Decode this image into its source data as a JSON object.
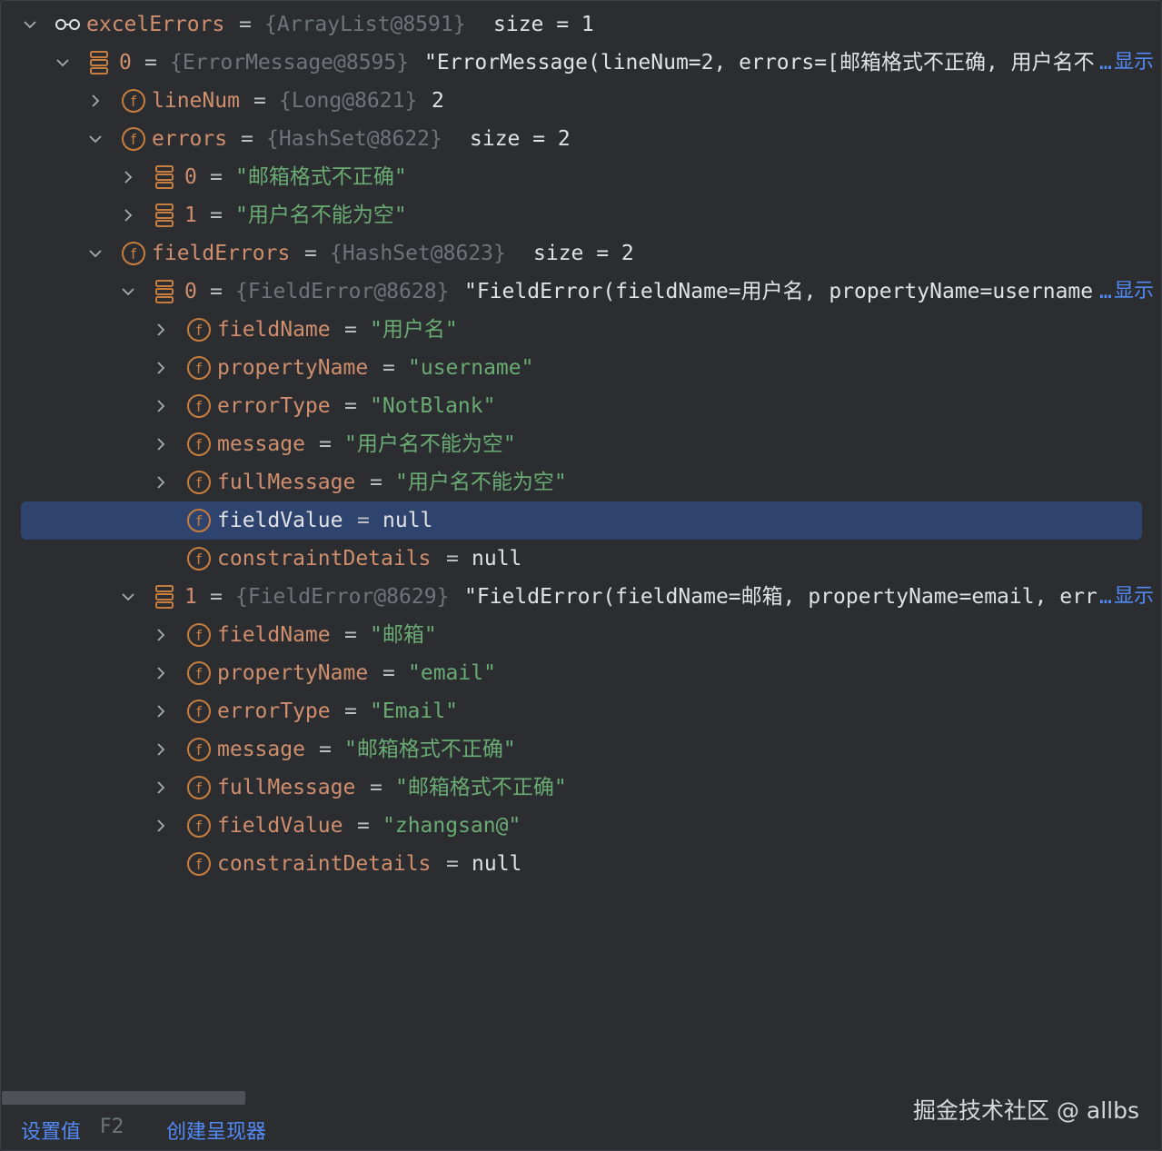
{
  "rows": [
    {
      "name": "excelErrors",
      "eq": "=",
      "ref": "{ArrayList@8591}",
      "extra": "size = 1"
    },
    {
      "name": "0",
      "eq": "=",
      "ref": "{ErrorMessage@8595}",
      "value": "\"ErrorMessage(lineNum=2, errors=[邮箱格式不正确, 用户名不",
      "ellipsis": "…",
      "show": "显示"
    },
    {
      "name": "lineNum",
      "eq": "=",
      "ref": "{Long@8621}",
      "value": "2"
    },
    {
      "name": "errors",
      "eq": "=",
      "ref": "{HashSet@8622}",
      "extra": "size = 2"
    },
    {
      "name": "0",
      "eq": "=",
      "value": "\"邮箱格式不正确\""
    },
    {
      "name": "1",
      "eq": "=",
      "value": "\"用户名不能为空\""
    },
    {
      "name": "fieldErrors",
      "eq": "=",
      "ref": "{HashSet@8623}",
      "extra": "size = 2"
    },
    {
      "name": "0",
      "eq": "=",
      "ref": "{FieldError@8628}",
      "value": "\"FieldError(fieldName=用户名, propertyName=username",
      "ellipsis": "…",
      "show": "显示"
    },
    {
      "name": "fieldName",
      "eq": "=",
      "value": "\"用户名\""
    },
    {
      "name": "propertyName",
      "eq": "=",
      "value": "\"username\""
    },
    {
      "name": "errorType",
      "eq": "=",
      "value": "\"NotBlank\""
    },
    {
      "name": "message",
      "eq": "=",
      "value": "\"用户名不能为空\""
    },
    {
      "name": "fullMessage",
      "eq": "=",
      "value": "\"用户名不能为空\""
    },
    {
      "name": "fieldValue",
      "eq": "=",
      "value": "null"
    },
    {
      "name": "constraintDetails",
      "eq": "=",
      "value": "null"
    },
    {
      "name": "1",
      "eq": "=",
      "ref": "{FieldError@8629}",
      "value": "\"FieldError(fieldName=邮箱, propertyName=email, err",
      "ellipsis": "…",
      "show": "显示"
    },
    {
      "name": "fieldName",
      "eq": "=",
      "value": "\"邮箱\""
    },
    {
      "name": "propertyName",
      "eq": "=",
      "value": "\"email\""
    },
    {
      "name": "errorType",
      "eq": "=",
      "value": "\"Email\""
    },
    {
      "name": "message",
      "eq": "=",
      "value": "\"邮箱格式不正确\""
    },
    {
      "name": "fullMessage",
      "eq": "=",
      "value": "\"邮箱格式不正确\""
    },
    {
      "name": "fieldValue",
      "eq": "=",
      "value": "\"zhangsan@\""
    },
    {
      "name": "constraintDetails",
      "eq": "=",
      "value": "null"
    }
  ],
  "bottom": {
    "set_value": "设置值",
    "set_value_shortcut": "F2",
    "create_renderer": "创建呈现器"
  },
  "watermark": "掘金技术社区 @ allbs",
  "colors": {
    "background": "#2b2d30",
    "selection": "#2e436e",
    "field_icon": "#c77d3e",
    "link": "#548af7",
    "string": "#6aab73",
    "reference": "#6f737a"
  },
  "selected_row_index": 13
}
